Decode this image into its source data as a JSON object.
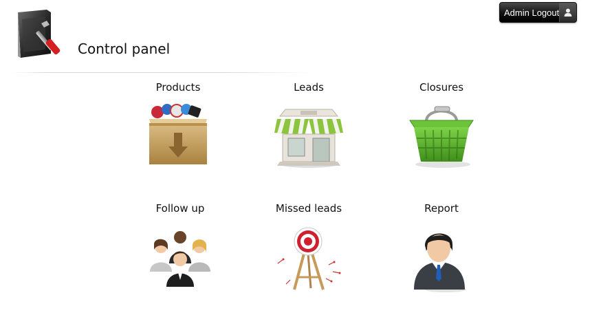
{
  "header": {
    "title": "Control panel",
    "icon": "folder-tools-icon"
  },
  "logout": {
    "label": "Admin Logout",
    "icon": "user-icon"
  },
  "tiles": [
    {
      "label": "Products",
      "icon": "box-download-icon"
    },
    {
      "label": "Leads",
      "icon": "storefront-icon"
    },
    {
      "label": "Closures",
      "icon": "shopping-basket-icon"
    },
    {
      "label": "Follow up",
      "icon": "people-group-icon"
    },
    {
      "label": "Missed leads",
      "icon": "target-easel-icon"
    },
    {
      "label": "Report",
      "icon": "businessman-icon"
    }
  ],
  "colors": {
    "basket_green": "#5fb62e",
    "box_tan": "#c9a266",
    "target_red": "#d01f2e",
    "awning_green": "#8cc43d"
  }
}
